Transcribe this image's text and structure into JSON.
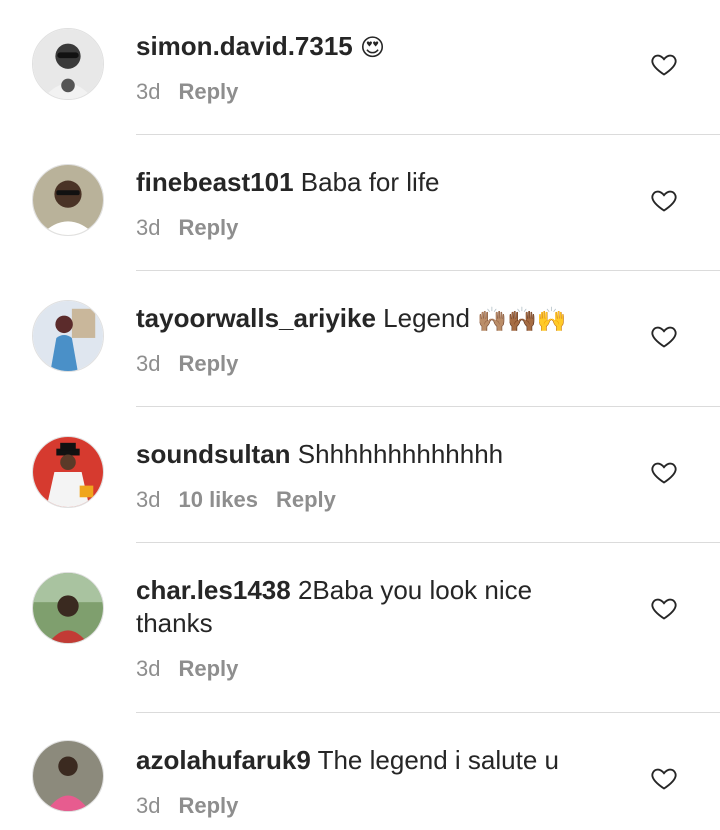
{
  "comments": [
    {
      "username": "simon.david.7315",
      "text": "",
      "emoji": "😍",
      "time": "3d",
      "likes": "",
      "reply": "Reply"
    },
    {
      "username": "finebeast101",
      "text": "Baba for life",
      "emoji": "",
      "time": "3d",
      "likes": "",
      "reply": "Reply"
    },
    {
      "username": "tayoorwalls_ariyike",
      "text": "Legend",
      "emoji": "🙌🏽🙌🏾🙌",
      "time": "3d",
      "likes": "",
      "reply": "Reply"
    },
    {
      "username": "soundsultan",
      "text": "Shhhhhhhhhhhhh",
      "emoji": "",
      "time": "3d",
      "likes": "10 likes",
      "reply": "Reply"
    },
    {
      "username": "char.les1438",
      "text": "2Baba you look nice thanks",
      "emoji": "",
      "time": "3d",
      "likes": "",
      "reply": "Reply"
    },
    {
      "username": "azolahufaruk9",
      "text": "The legend i salute u",
      "emoji": "",
      "time": "3d",
      "likes": "",
      "reply": "Reply"
    }
  ],
  "colors": {
    "text": "#262626",
    "meta": "#8e8e8e",
    "divider": "#dbdbdb"
  },
  "icons": {
    "like": "heart-outline-icon"
  }
}
